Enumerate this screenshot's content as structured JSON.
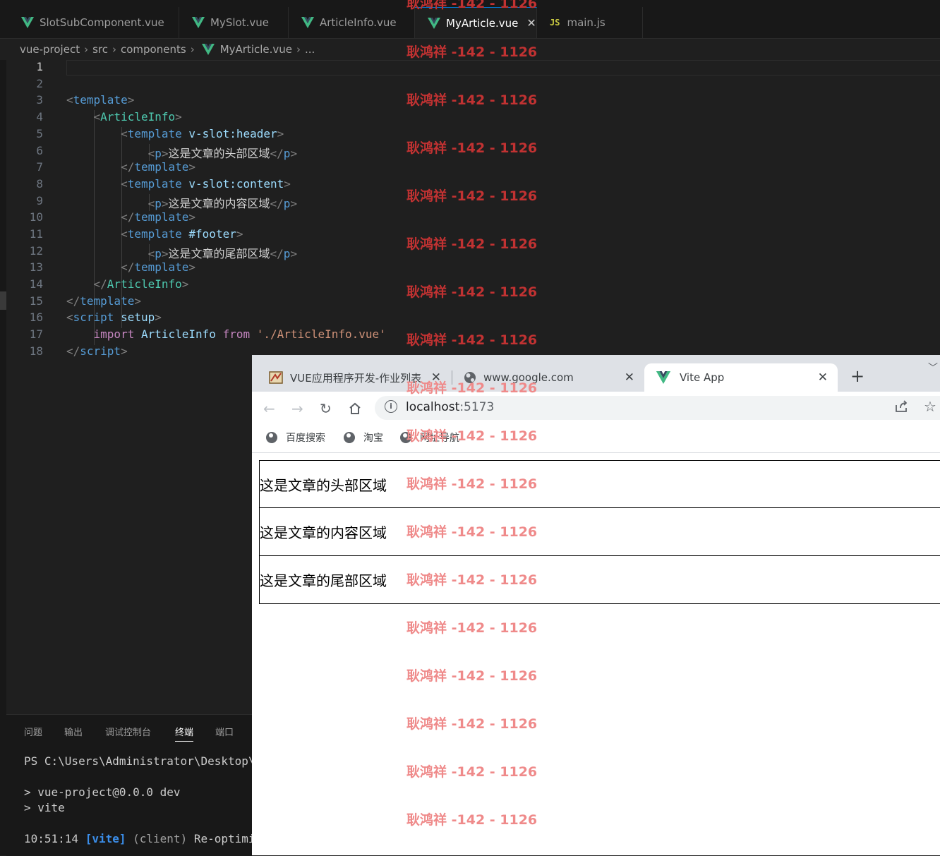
{
  "editor": {
    "tabs": [
      {
        "label": "SlotSubComponent.vue",
        "icon": "vue-icon"
      },
      {
        "label": "MySlot.vue",
        "icon": "vue-icon"
      },
      {
        "label": "ArticleInfo.vue",
        "icon": "vue-icon"
      },
      {
        "label": "MyArticle.vue",
        "icon": "vue-icon",
        "active": true
      },
      {
        "label": "main.js",
        "icon": "js-icon",
        "icon_text": "JS"
      }
    ],
    "breadcrumb": [
      "vue-project",
      "src",
      "components",
      "MyArticle.vue",
      "..."
    ],
    "line_numbers": [
      "1",
      "2",
      "3",
      "4",
      "5",
      "6",
      "7",
      "8",
      "9",
      "10",
      "11",
      "12",
      "13",
      "14",
      "15",
      "16",
      "17",
      "18"
    ],
    "code": {
      "template_kw": "template",
      "article_info": "ArticleInfo",
      "v_slot": "v-slot",
      "header_arg": "header",
      "content_arg": "content",
      "footer_short": "#footer",
      "p_tag": "p",
      "header_text": "这是文章的头部区域",
      "content_text": "这是文章的内容区域",
      "footer_text": "这是文章的尾部区域",
      "script_kw": "script",
      "setup_attr": "setup",
      "import_kw": "import",
      "from_kw": "from",
      "import_path": "'./ArticleInfo.vue'"
    }
  },
  "panel": {
    "tabs": [
      "问题",
      "输出",
      "调试控制台",
      "终端",
      "端口"
    ],
    "active_tab": "终端",
    "terminal": {
      "prompt_line": "PS C:\\Users\\Administrator\\Desktop\\vu",
      "line1": "> vue-project@0.0.0 dev",
      "line2": "> vite",
      "time": "10:51:14",
      "vite_tag": "[vite]",
      "client": "(client)",
      "message": "Re-optimizi"
    }
  },
  "browser": {
    "tabs": [
      {
        "title": "VUE应用程序开发-作业列表",
        "icon": "course-icon"
      },
      {
        "title": "www.google.com",
        "icon": "globe-icon"
      },
      {
        "title": "Vite App",
        "icon": "vue-icon",
        "active": true
      }
    ],
    "url_host": "localhost",
    "url_port": ":5173",
    "bookmarks": [
      "百度搜索",
      "淘宝",
      "网址导航"
    ],
    "content": [
      "这是文章的头部区域",
      "这是文章的内容区域",
      "这是文章的尾部区域"
    ]
  },
  "watermark": {
    "text": "耿鸿祥 -142 - 1126",
    "color_dark": "#c13232",
    "color_light": "#ef8a8a"
  },
  "colors": {
    "vscode_bg": "#1f1f1f",
    "accent": "#0078d4",
    "vue_green": "#41b883"
  }
}
